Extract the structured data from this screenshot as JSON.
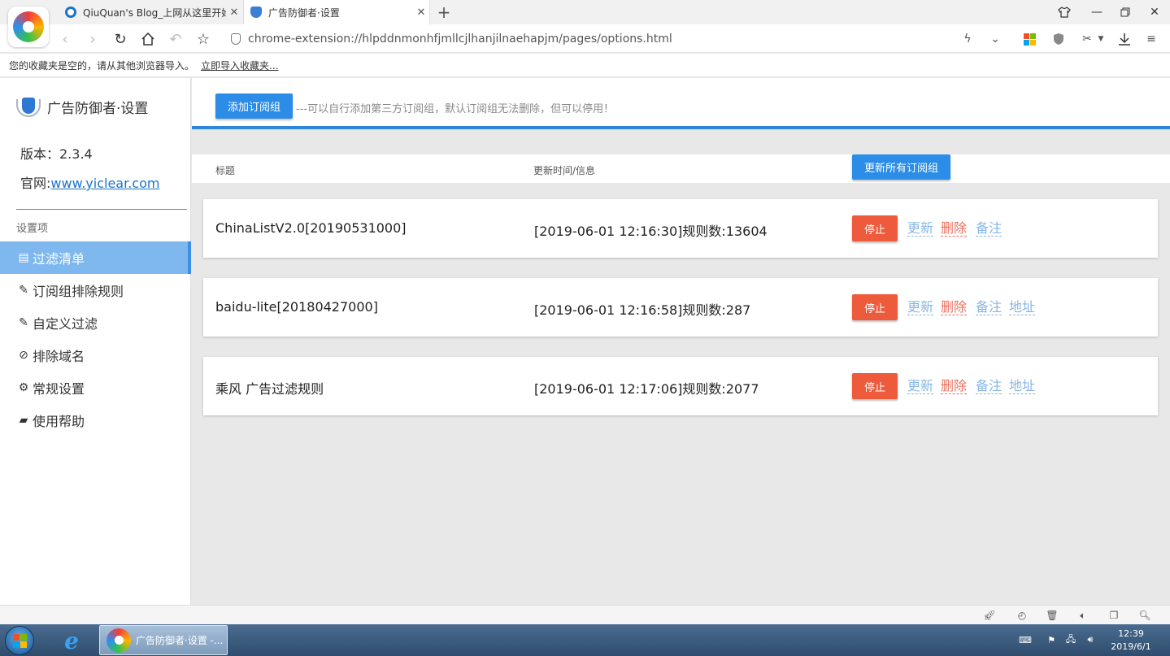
{
  "browser": {
    "tabs": [
      {
        "title": "QiuQuan's Blog_上网从这里开始"
      },
      {
        "title": "广告防御者·设置"
      }
    ],
    "url": "chrome-extension://hlpddnmonhfjmllcjlhanjilnaehapjm/pages/options.html",
    "bookmarks_empty_text": "您的收藏夹是空的，请从其他浏览器导入。",
    "bookmarks_import_link": "立即导入收藏夹..."
  },
  "sidebar": {
    "app_title": "广告防御者·设置",
    "version_text": "版本：2.3.4",
    "site_label": "官网:",
    "site_link": "www.yiclear.com",
    "section_label": "设置项",
    "menu": [
      {
        "label": "过滤清单",
        "icon": "list-icon",
        "glyph": "▤",
        "active": true
      },
      {
        "label": "订阅组排除规则",
        "icon": "pencil-icon",
        "glyph": "✎",
        "active": false
      },
      {
        "label": "自定义过滤",
        "icon": "pencil-icon",
        "glyph": "✎",
        "active": false
      },
      {
        "label": "排除域名",
        "icon": "ban-icon",
        "glyph": "⊘",
        "active": false
      },
      {
        "label": "常规设置",
        "icon": "gears-icon",
        "glyph": "⚙",
        "active": false
      },
      {
        "label": "使用帮助",
        "icon": "book-icon",
        "glyph": "▰",
        "active": false
      }
    ]
  },
  "main": {
    "add_button": "添加订阅组",
    "hint": "---可以自行添加第三方订阅组，默认订阅组无法删除，但可以停用！",
    "col_title": "标题",
    "col_info": "更新时间/信息",
    "update_all_button": "更新所有订阅组",
    "subscriptions": [
      {
        "title": "ChinaListV2.0[20190531000]",
        "info": "[2019-06-01 12:16:30]规则数:13604",
        "stop": "停止",
        "update": "更新",
        "delete": "删除",
        "note": "备注",
        "address": ""
      },
      {
        "title": "baidu-lite[20180427000]",
        "info": "[2019-06-01 12:16:58]规则数:287",
        "stop": "停止",
        "update": "更新",
        "delete": "删除",
        "note": "备注",
        "address": "地址"
      },
      {
        "title": "乘风 广告过滤规则",
        "info": "[2019-06-01 12:17:06]规则数:2077",
        "stop": "停止",
        "update": "更新",
        "delete": "删除",
        "note": "备注",
        "address": "地址"
      }
    ]
  },
  "taskbar": {
    "active_window": "广告防御者·设置 -...",
    "time": "12:39",
    "date": "2019/6/1"
  },
  "colors": {
    "accent": "#2b8de8",
    "active_menu": "#7fb8ef",
    "stop_button": "#ee5a3c",
    "link_blue": "#87b6e4",
    "link_red": "#e8705e"
  }
}
